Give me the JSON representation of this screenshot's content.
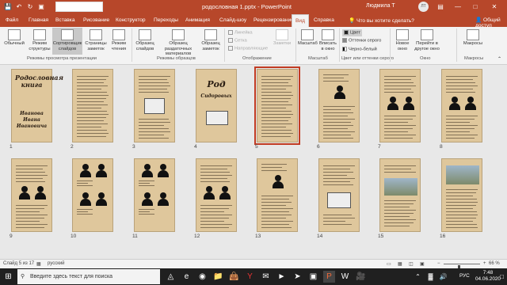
{
  "window": {
    "title": "родословная 1.pptx  -  PowerPoint",
    "user": "Людмила Т",
    "user_initials": "ЛТ",
    "icons": {
      "save": "save-icon",
      "undo": "undo-icon",
      "redo": "redo-icon",
      "present": "present-icon"
    }
  },
  "tabs": [
    "Файл",
    "Главная",
    "Вставка",
    "Рисование",
    "Конструктор",
    "Переходы",
    "Анимация",
    "Слайд-шоу",
    "Рецензирование",
    "Вид",
    "Справка"
  ],
  "active_tab": "Вид",
  "tellme": "Что вы хотите сделать?",
  "share": "Общий доступ",
  "ribbon": {
    "view_buttons": [
      "Обычный",
      "Режим структуры",
      "Сортировщик слайдов",
      "Страницы заметок",
      "Режим чтения"
    ],
    "view_group": "Режимы просмотра презентации",
    "master_buttons": [
      "Образец слайдов",
      "Образец раздаточных материалов",
      "Образец заметок"
    ],
    "master_group": "Режимы образцов",
    "show_items": [
      "Линейка",
      "Сетка",
      "Направляющие"
    ],
    "notes_label": "Заметки",
    "show_group": "Отображение",
    "zoom_buttons": [
      "Масштаб",
      "Вписать в окно"
    ],
    "zoom_group": "Масштаб",
    "color_items": [
      "Цвет",
      "Оттенки серого",
      "Черно-белый"
    ],
    "color_group": "Цвет или оттенки серого",
    "window_buttons": [
      "Новое окно",
      "Перейти в другое окно"
    ],
    "window_group": "Окно",
    "macro_button": "Макросы",
    "macro_group": "Макросы"
  },
  "slides": [
    {
      "num": "1",
      "title": "Родословная книга",
      "subtitle": "Иванова Ивана Ивановича",
      "kind": "title"
    },
    {
      "num": "2",
      "kind": "text"
    },
    {
      "num": "3",
      "kind": "text-image"
    },
    {
      "num": "4",
      "title": "Род",
      "subtitle": "Сидоровых",
      "kind": "book"
    },
    {
      "num": "5",
      "kind": "text",
      "selected": true
    },
    {
      "num": "6",
      "kind": "person-1"
    },
    {
      "num": "7",
      "kind": "person-2"
    },
    {
      "num": "8",
      "kind": "person-2"
    },
    {
      "num": "9",
      "kind": "person-2"
    },
    {
      "num": "10",
      "kind": "person-4"
    },
    {
      "num": "11",
      "kind": "person-4"
    },
    {
      "num": "12",
      "kind": "person-2"
    },
    {
      "num": "13",
      "kind": "person-1"
    },
    {
      "num": "14",
      "kind": "book"
    },
    {
      "num": "15",
      "kind": "photo"
    },
    {
      "num": "16",
      "kind": "photo"
    }
  ],
  "status": {
    "slide_info": "Слайд 5 из 17",
    "language": "русский",
    "zoom": "66 %",
    "zoom_level_percent": 66
  },
  "taskbar": {
    "search_placeholder": "Введите здесь текст для поиска",
    "lang": "РУС",
    "time": "7:48",
    "date": "04.06.2020"
  }
}
